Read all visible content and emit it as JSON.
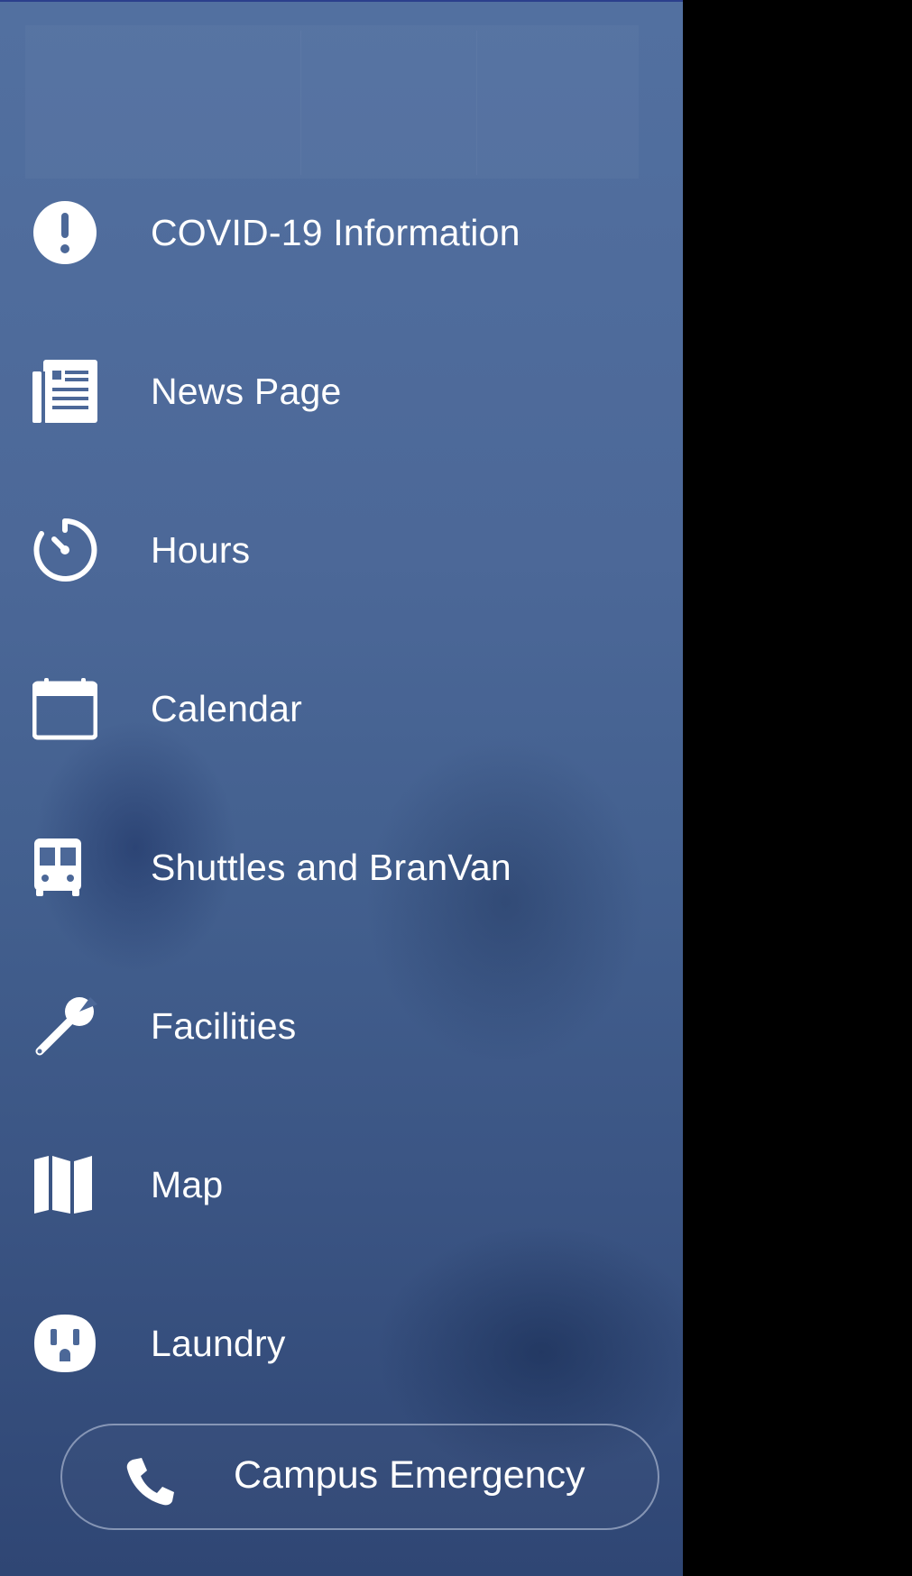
{
  "colors": {
    "drawer_top": "#5270a0",
    "drawer_bottom": "#2f4674",
    "text": "#ffffff",
    "backdrop": "#000000",
    "top_strip": "#2b3f8c"
  },
  "menu": {
    "items": [
      {
        "label": "COVID-19 Information",
        "icon": "exclamation-circle-icon"
      },
      {
        "label": "News Page",
        "icon": "newspaper-icon"
      },
      {
        "label": "Hours",
        "icon": "stopwatch-icon"
      },
      {
        "label": "Calendar",
        "icon": "calendar-icon"
      },
      {
        "label": "Shuttles and BranVan",
        "icon": "bus-icon"
      },
      {
        "label": "Facilities",
        "icon": "wrench-icon"
      },
      {
        "label": "Map",
        "icon": "map-icon"
      },
      {
        "label": "Laundry",
        "icon": "power-outlet-icon"
      }
    ]
  },
  "emergency": {
    "label": "Campus Emergency",
    "icon": "phone-icon"
  }
}
